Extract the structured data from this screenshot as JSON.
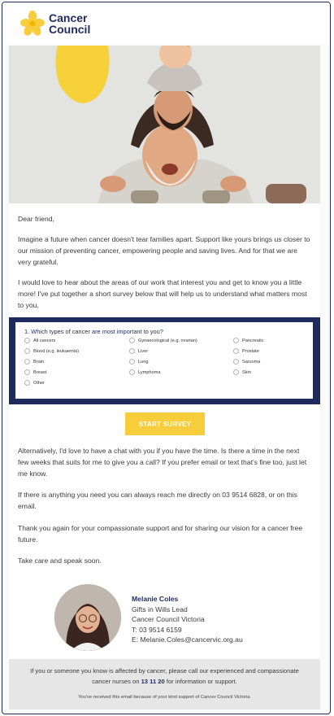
{
  "brand": {
    "name_line1": "Cancer",
    "name_line2": "Council",
    "primary_color": "#1f2b5e",
    "accent_color": "#f8cd3b",
    "logo_icon": "daffodil-icon"
  },
  "letter": {
    "greeting": "Dear friend,",
    "p1": "Imagine a future when cancer doesn't tear families apart. Support like yours brings us closer to our mission of preventing cancer, empowering people and saving lives. And for that we are very grateful.",
    "p2": "I would love to hear about the areas of our work that interest you and get to know you a little more! I've put together a short survey below that will help us to understand what matters most to you.",
    "p3": "Alternatively, I'd love to have a chat with you if you have the time. Is there a time in the next few weeks that suits for me to give you a call? If you prefer email or text that's fine too, just let me know.",
    "p4": "If there is anything you need you can always reach me directly on 03 9514 6828, or on this email.",
    "p5": "Thank you again for your compassionate support and for sharing our vision for a cancer free future.",
    "p6": "Take care and speak soon."
  },
  "survey": {
    "question": "1.   Which types of cancer are most important to you?",
    "options": [
      "All cancers",
      "Gynaecological (e.g. ovarian)",
      "Pancreatic",
      "Blood (e.g. leukaemia)",
      "Liver",
      "Prostate",
      "Brain",
      "Lung",
      "Sarcoma",
      "Breast",
      "Lymphoma",
      "Skin",
      "Other"
    ],
    "button_label": "START SURVEY"
  },
  "signature": {
    "name": "Melanie Coles",
    "role": "Gifts in Wills Lead",
    "org": "Cancer Council Victoria",
    "phone": "T: 03 9514 6159",
    "email": "E: Melanie.Coles@cancervic.org.au"
  },
  "footer": {
    "text_before": "If you or someone you know is affected by cancer, please call our experienced and compassionate cancer nurses on ",
    "phone": "13 11 20",
    "text_after": " for information or support.",
    "disclaimer": "You've received this email because of your kind support of Cancer Council Victoria."
  }
}
